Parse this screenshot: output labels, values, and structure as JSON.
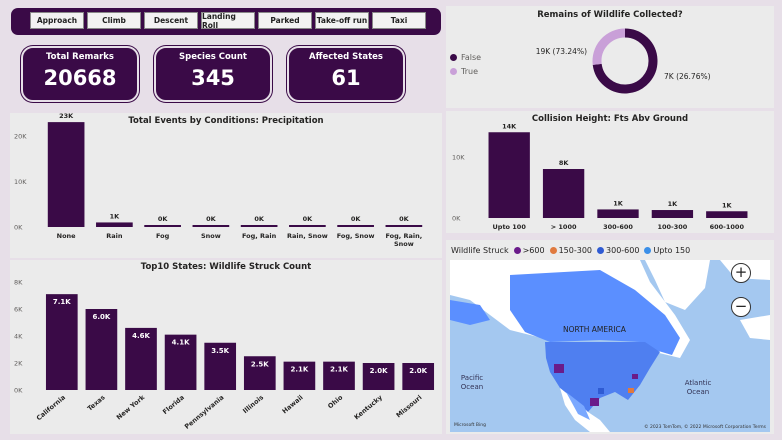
{
  "phases": [
    "Approach",
    "Climb",
    "Descent",
    "Landing Roll",
    "Parked",
    "Take-off run",
    "Taxi"
  ],
  "kpis": [
    {
      "title": "Total Remarks",
      "value": "20668"
    },
    {
      "title": "Species Count",
      "value": "345"
    },
    {
      "title": "Affected States",
      "value": "61"
    }
  ],
  "colors": {
    "primary": "#3a0a47",
    "secondary": "#c9a0d8",
    "panel": "#ebebeb",
    "map_water": "#a4c8f0",
    "map_land": "#ffffff",
    "map_us": "#5b8fff"
  },
  "map": {
    "legend_title": "Wildlife Struck",
    "legend_items": [
      {
        "label": ">600",
        "color": "#6a1b8a"
      },
      {
        "label": "150-300",
        "color": "#e07a3f"
      },
      {
        "label": "300-600",
        "color": "#2f5bd3"
      },
      {
        "label": "Upto 150",
        "color": "#3a8fe8"
      }
    ],
    "labels": {
      "continent": "NORTH AMERICA",
      "pacific": "Pacific\nOcean",
      "atlantic": "Atlantic\nOcean"
    },
    "bing": "Microsoft Bing",
    "credit": "© 2023 TomTom, © 2022 Microsoft Corporation Terms",
    "zoom_in": "+",
    "zoom_out": "−"
  },
  "chart_data": [
    {
      "id": "donut",
      "type": "pie",
      "title": "Remains of Wildlife Collected?",
      "categories": [
        "False",
        "True"
      ],
      "values": [
        19000,
        7000
      ],
      "data_labels": [
        "19K (73.24%)",
        "7K (26.76%)"
      ],
      "percent": [
        73.24,
        26.76
      ],
      "colors": [
        "#3a0a47",
        "#c9a0d8"
      ],
      "legend_position": "left"
    },
    {
      "id": "precip",
      "type": "bar",
      "title": "Total Events by Conditions: Precipitation",
      "categories": [
        [
          "None"
        ],
        [
          "Rain"
        ],
        [
          "Fog"
        ],
        [
          "Snow"
        ],
        [
          "Fog, Rain"
        ],
        [
          "Rain, Snow"
        ],
        [
          "Fog, Snow"
        ],
        [
          "Fog, Rain,",
          "Snow"
        ]
      ],
      "values": [
        23000,
        1000,
        400,
        100,
        80,
        50,
        30,
        20
      ],
      "data_labels": [
        "23K",
        "1K",
        "0K",
        "0K",
        "0K",
        "0K",
        "0K",
        "0K"
      ],
      "yticks": [
        "0K",
        "10K",
        "20K"
      ],
      "ytick_values": [
        0,
        10000,
        20000
      ],
      "ylim": [
        0,
        25000
      ]
    },
    {
      "id": "height",
      "type": "bar",
      "title": "Collision Height: Fts Abv Ground",
      "categories": [
        [
          "Upto 100"
        ],
        [
          "> 1000"
        ],
        [
          "300-600"
        ],
        [
          "100-300"
        ],
        [
          "600-1000"
        ]
      ],
      "values": [
        14000,
        8000,
        1400,
        1300,
        1100
      ],
      "data_labels": [
        "14K",
        "8K",
        "1K",
        "1K",
        "1K"
      ],
      "yticks": [
        "0K",
        "10K"
      ],
      "ytick_values": [
        0,
        10000
      ],
      "ylim": [
        0,
        16000
      ]
    },
    {
      "id": "states",
      "type": "bar",
      "title": "Top10 States: Wildlife Struck Count",
      "categories": [
        "California",
        "Texas",
        "New York",
        "Florida",
        "Pennsylvania",
        "Illinois",
        "Hawaii",
        "Ohio",
        "Kentucky",
        "Missouri"
      ],
      "values": [
        7100,
        6000,
        4600,
        4100,
        3500,
        2500,
        2100,
        2100,
        2000,
        2000
      ],
      "data_labels": [
        "7.1K",
        "6.0K",
        "4.6K",
        "4.1K",
        "3.5K",
        "2.5K",
        "2.1K",
        "2.1K",
        "2.0K",
        "2.0K"
      ],
      "yticks": [
        "0K",
        "2K",
        "4K",
        "6K",
        "8K"
      ],
      "ytick_values": [
        0,
        2000,
        4000,
        6000,
        8000
      ],
      "ylim": [
        0,
        8000
      ]
    }
  ]
}
